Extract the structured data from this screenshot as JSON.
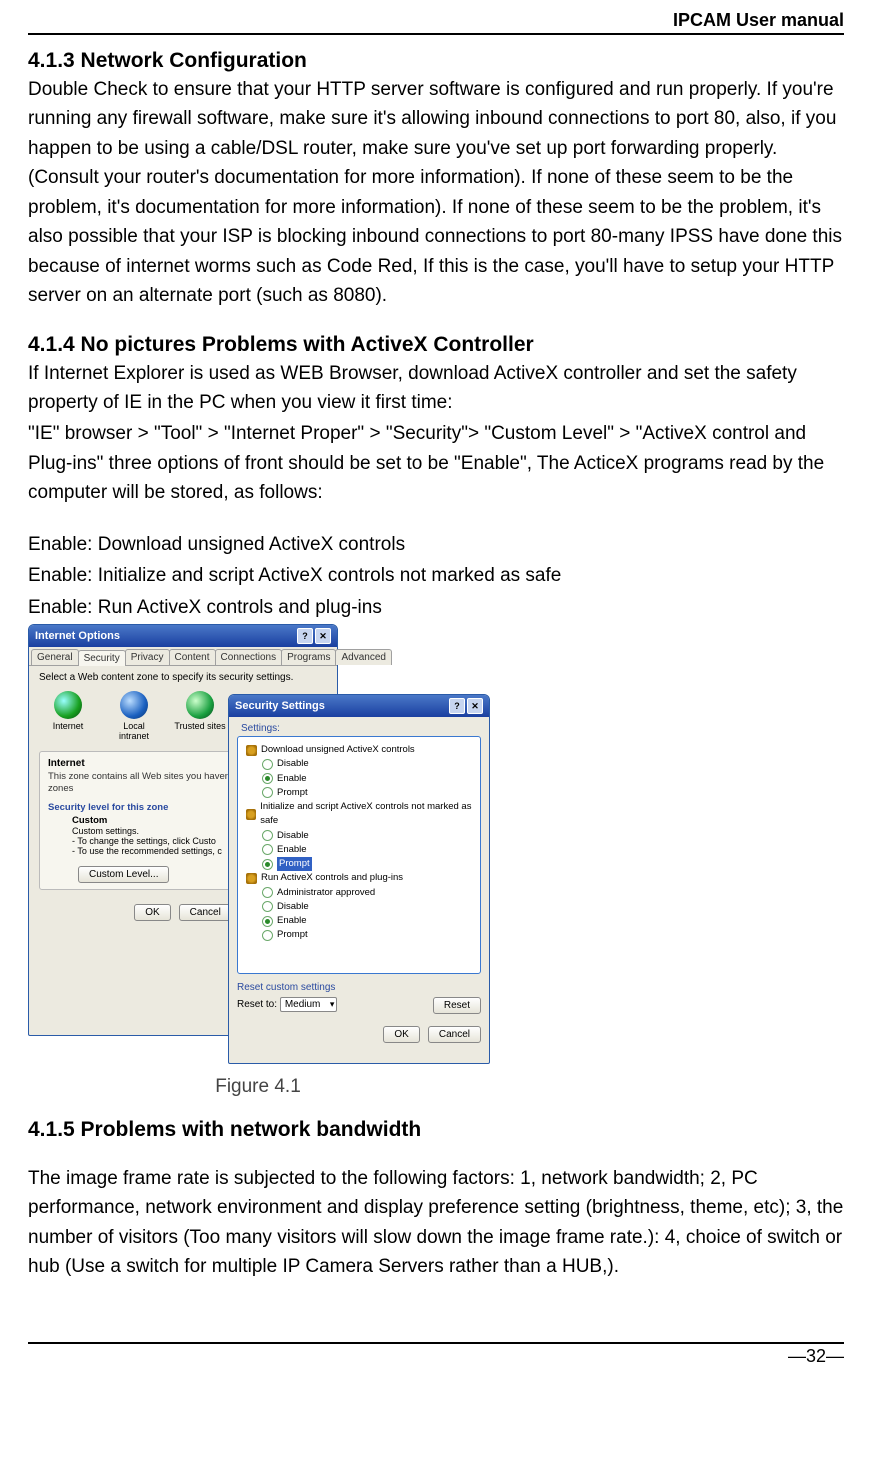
{
  "header": {
    "title": "IPCAM User manual"
  },
  "sections": {
    "s1": {
      "heading": "4.1.3 Network Configuration",
      "para": "Double Check to ensure that your HTTP server software is configured and run properly. If you're running any firewall software, make sure it's allowing inbound connections to port 80, also, if you happen to be using a cable/DSL router, make sure you've set up port forwarding properly. (Consult your router's documentation for more information). If none of these seem to be the problem, it's documentation for more information). If none of these seem to be the problem, it's also possible that your ISP is blocking inbound connections to port 80-many IPSS have done this because of internet worms such as Code Red, If this is the case, you'll have to setup your HTTP server on an alternate port (such as 8080)."
    },
    "s2": {
      "heading": "4.1.4 No pictures Problems with ActiveX Controller",
      "para1": "If Internet Explorer is used as WEB Browser, download ActiveX controller and set the safety property of IE in the PC when you view it first time:",
      "para2": "\"IE\" browser > \"Tool\" > \"Internet Proper\" > \"Security\"> \"Custom Level\" > \"ActiveX control and Plug-ins\" three options of front should be set to be \"Enable\", The ActiceX programs read by the computer will be stored, as follows:",
      "enable1": "Enable: Download unsigned ActiveX controls",
      "enable2": "Enable: Initialize and script ActiveX controls not marked as safe",
      "enable3": "Enable: Run ActiveX controls and plug-ins"
    },
    "s3": {
      "heading": "4.1.5 Problems with network bandwidth",
      "para": "The image frame rate is subjected to the following factors: 1, network bandwidth; 2, PC performance, network environment and display preference setting (brightness, theme, etc); 3, the number of visitors (Too many visitors will slow down the image frame rate.): 4, choice of switch or hub (Use a switch for multiple IP Camera Servers rather than a HUB,)."
    }
  },
  "figure": {
    "caption": "Figure 4.1",
    "io": {
      "title": "Internet Options",
      "tabs": [
        "General",
        "Security",
        "Privacy",
        "Content",
        "Connections",
        "Programs",
        "Advanced"
      ],
      "zone_label": "Select a Web content zone to specify its security settings.",
      "zones": [
        "Internet",
        "Local intranet",
        "Trusted sites"
      ],
      "internet_group_title": "Internet",
      "internet_group_text": "This zone contains all Web sites you haven't placed in other zones",
      "sec_level_label": "Security level for this zone",
      "custom_title": "Custom",
      "custom_sub": "Custom settings.",
      "custom_line1": "- To change the settings, click Custo",
      "custom_line2": "- To use the recommended settings, c",
      "btn_custom": "Custom Level...",
      "btn_ok": "OK",
      "btn_cancel": "Cancel"
    },
    "ss": {
      "title": "Security Settings",
      "settings_label": "Settings:",
      "tree": {
        "n1": "Download unsigned ActiveX controls",
        "n1a": "Disable",
        "n1b": "Enable",
        "n1c": "Prompt",
        "n2": "Initialize and script ActiveX controls not marked as safe",
        "n2a": "Disable",
        "n2b": "Enable",
        "n2c": "Prompt",
        "n3": "Run ActiveX controls and plug-ins",
        "n3a": "Administrator approved",
        "n3b": "Disable",
        "n3c": "Enable",
        "n3d": "Prompt"
      },
      "reset_label": "Reset custom settings",
      "reset_to": "Reset to:",
      "reset_value": "Medium",
      "btn_reset": "Reset",
      "btn_ok": "OK",
      "btn_cancel": "Cancel"
    }
  },
  "footer": {
    "page": "—32—"
  }
}
